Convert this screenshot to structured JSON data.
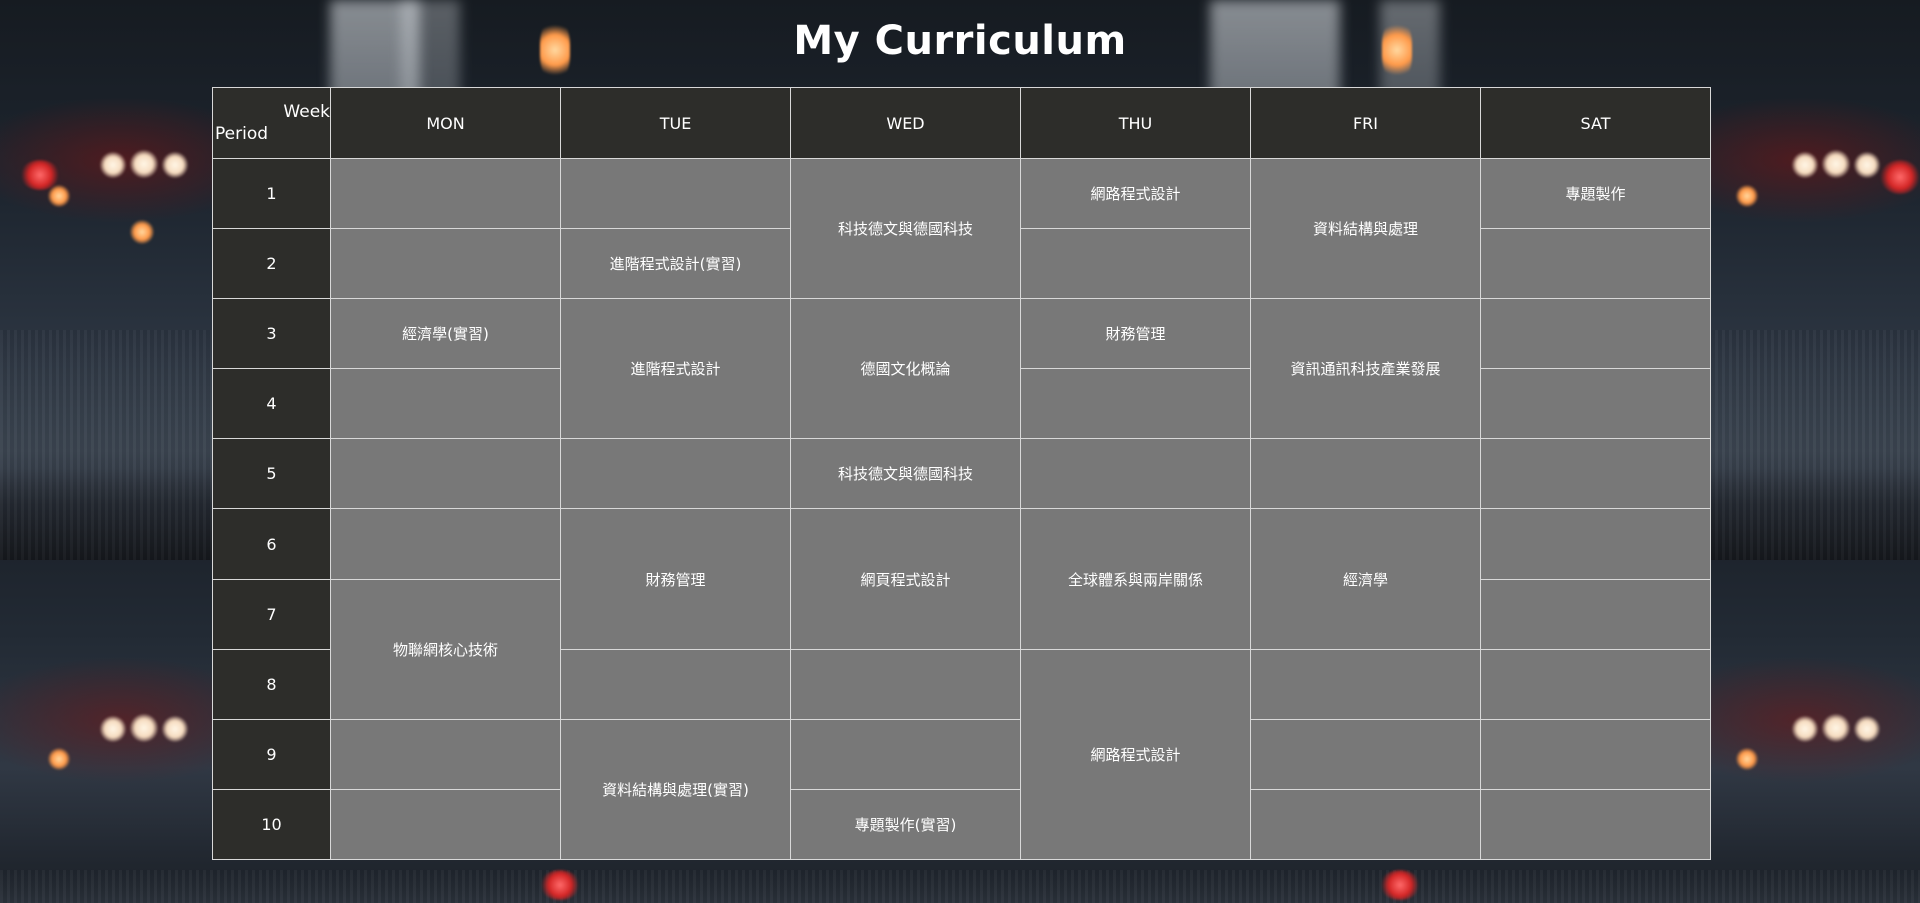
{
  "page": {
    "title": "My Curriculum"
  },
  "corner": {
    "week_label": "Week",
    "period_label": "Period"
  },
  "days": [
    "MON",
    "TUE",
    "WED",
    "THU",
    "FRI",
    "SAT"
  ],
  "periods": [
    "1",
    "2",
    "3",
    "4",
    "5",
    "6",
    "7",
    "8",
    "9",
    "10"
  ],
  "courses": {
    "mon": {
      "p3": "經濟學(實習)",
      "p7_8": "物聯網核心技術"
    },
    "tue": {
      "p2": "進階程式設計(實習)",
      "p3_4": "進階程式設計",
      "p6_7": "財務管理",
      "p9_10": "資料結構與處理(實習)"
    },
    "wed": {
      "p1_2": "科技德文與德國科技",
      "p3_4": "德國文化概論",
      "p5": "科技德文與德國科技",
      "p6_7": "網頁程式設計",
      "p10": "專題製作(實習)"
    },
    "thu": {
      "p1": "網路程式設計",
      "p3": "財務管理",
      "p6_7": "全球體系與兩岸關係",
      "p8_10": "網路程式設計"
    },
    "fri": {
      "p1_2": "資料結構與處理",
      "p3_4": "資訊通訊科技產業發展",
      "p6_7": "經濟學"
    },
    "sat": {
      "p1": "專題製作"
    }
  },
  "colors": {
    "header_bg": "#2d2d2a",
    "cell_bg": "#787878",
    "border": "#d8d8d8",
    "text": "#ffffff"
  }
}
